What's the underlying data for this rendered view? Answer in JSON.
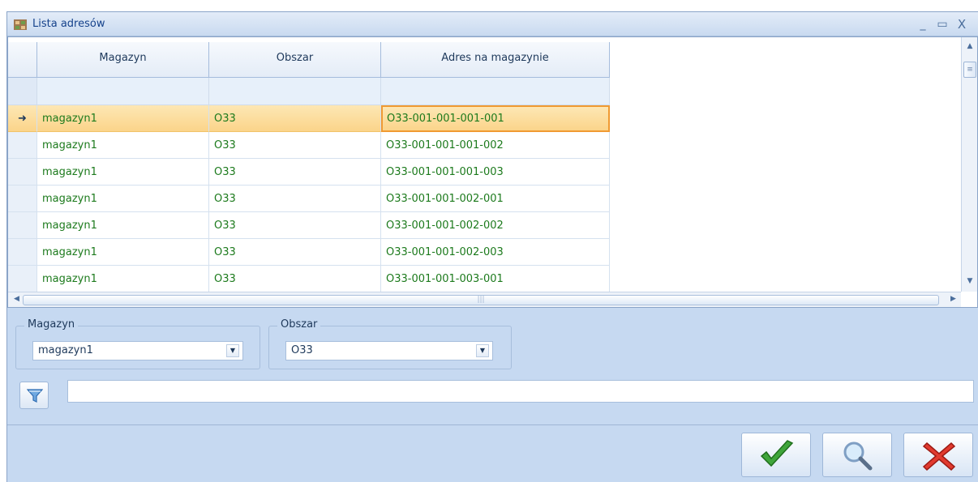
{
  "window": {
    "title": "Lista adresów"
  },
  "grid": {
    "columns": [
      "Magazyn",
      "Obszar",
      "Adres na magazynie"
    ],
    "rows": [
      [
        "magazyn1",
        "O33",
        "O33-001-001-001-001"
      ],
      [
        "magazyn1",
        "O33",
        "O33-001-001-001-002"
      ],
      [
        "magazyn1",
        "O33",
        "O33-001-001-001-003"
      ],
      [
        "magazyn1",
        "O33",
        "O33-001-001-002-001"
      ],
      [
        "magazyn1",
        "O33",
        "O33-001-001-002-002"
      ],
      [
        "magazyn1",
        "O33",
        "O33-001-001-002-003"
      ],
      [
        "magazyn1",
        "O33",
        "O33-001-001-003-001"
      ]
    ],
    "selected_row": 0
  },
  "filters": {
    "magazyn": {
      "label": "Magazyn",
      "value": "magazyn1"
    },
    "obszar": {
      "label": "Obszar",
      "value": "O33"
    },
    "text_filter": {
      "value": ""
    }
  },
  "icons": {
    "app": "shelf-icon",
    "filter": "funnel-icon",
    "ok": "checkmark-icon",
    "search": "magnifier-icon",
    "cancel": "red-x-icon"
  },
  "colors": {
    "cell_text": "#1c7a1c",
    "selection": "#fbd48a",
    "selection_border": "#f09a32",
    "window_bg": "#c6d9f1"
  }
}
